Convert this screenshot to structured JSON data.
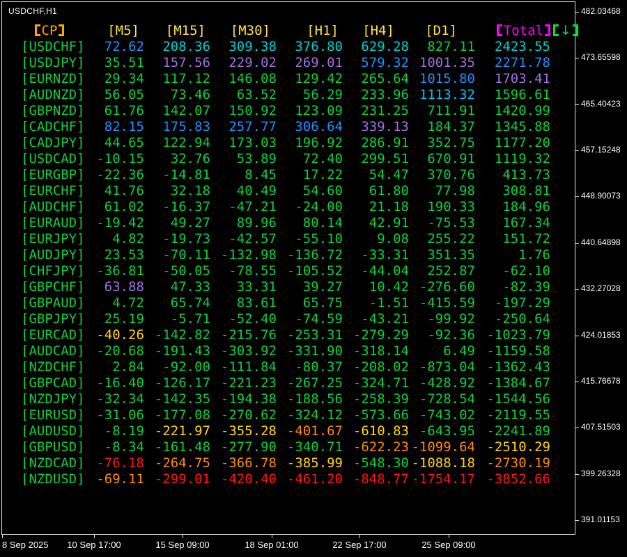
{
  "window": {
    "title": "USDCHF,H1"
  },
  "palette": {
    "background": "#000000",
    "frame": "#E6E6E6",
    "axis_text": "#FFFFFF",
    "pair": "#0ECF3A",
    "green": "#0ECF3A",
    "blue": "#1E90FF",
    "cyan": "#00CED1",
    "sky": "#00BFFF",
    "purple": "#9B72DE",
    "yellow": "#FFD700",
    "orange": "#FF8C00",
    "red": "#FF1414",
    "header_cp": "#FFA500",
    "header_tf": "#FFE135",
    "header_total": "#FF00FF",
    "header_arrow": "#00E62E"
  },
  "table": {
    "header": {
      "cp": "【CP】",
      "timeframes": [
        "[M5]",
        "[M15]",
        "[M30]",
        "[H1]",
        "[H4]",
        "[D1]"
      ],
      "total": "【Total】",
      "sort": "【↓】"
    },
    "rows": [
      {
        "pair": "[USDCHF]",
        "cells": [
          [
            "72.62",
            "blue"
          ],
          [
            "208.36",
            "cyan"
          ],
          [
            "309.38",
            "cyan"
          ],
          [
            "376.80",
            "cyan"
          ],
          [
            "629.28",
            "cyan"
          ],
          [
            "827.11",
            "green"
          ],
          [
            "2423.55",
            "cyan"
          ]
        ]
      },
      {
        "pair": "[USDJPY]",
        "cells": [
          [
            "35.51",
            "green"
          ],
          [
            "157.56",
            "purple"
          ],
          [
            "229.02",
            "purple"
          ],
          [
            "269.01",
            "purple"
          ],
          [
            "579.32",
            "blue"
          ],
          [
            "1001.35",
            "purple"
          ],
          [
            "2271.78",
            "blue"
          ]
        ]
      },
      {
        "pair": "[EURNZD]",
        "cells": [
          [
            "29.34",
            "green"
          ],
          [
            "117.12",
            "green"
          ],
          [
            "146.08",
            "green"
          ],
          [
            "129.42",
            "green"
          ],
          [
            "265.64",
            "green"
          ],
          [
            "1015.80",
            "blue"
          ],
          [
            "1703.41",
            "purple"
          ]
        ]
      },
      {
        "pair": "[AUDNZD]",
        "cells": [
          [
            "56.05",
            "green"
          ],
          [
            "73.46",
            "green"
          ],
          [
            "63.52",
            "green"
          ],
          [
            "56.29",
            "green"
          ],
          [
            "233.96",
            "green"
          ],
          [
            "1113.32",
            "sky"
          ],
          [
            "1596.61",
            "green"
          ]
        ]
      },
      {
        "pair": "[GBPNZD]",
        "cells": [
          [
            "61.76",
            "green"
          ],
          [
            "142.07",
            "green"
          ],
          [
            "150.92",
            "green"
          ],
          [
            "123.09",
            "green"
          ],
          [
            "231.25",
            "green"
          ],
          [
            "711.91",
            "green"
          ],
          [
            "1420.99",
            "green"
          ]
        ]
      },
      {
        "pair": "[CADCHF]",
        "cells": [
          [
            "82.15",
            "blue"
          ],
          [
            "175.83",
            "blue"
          ],
          [
            "257.77",
            "blue"
          ],
          [
            "306.64",
            "blue"
          ],
          [
            "339.13",
            "purple"
          ],
          [
            "184.37",
            "green"
          ],
          [
            "1345.88",
            "green"
          ]
        ]
      },
      {
        "pair": "[CADJPY]",
        "cells": [
          [
            "44.65",
            "green"
          ],
          [
            "122.94",
            "green"
          ],
          [
            "173.03",
            "green"
          ],
          [
            "196.92",
            "green"
          ],
          [
            "286.91",
            "green"
          ],
          [
            "352.75",
            "green"
          ],
          [
            "1177.20",
            "green"
          ]
        ]
      },
      {
        "pair": "[USDCAD]",
        "cells": [
          [
            "-10.15",
            "green"
          ],
          [
            "32.76",
            "green"
          ],
          [
            "53.89",
            "green"
          ],
          [
            "72.40",
            "green"
          ],
          [
            "299.51",
            "green"
          ],
          [
            "670.91",
            "green"
          ],
          [
            "1119.32",
            "green"
          ]
        ]
      },
      {
        "pair": "[EURGBP]",
        "cells": [
          [
            "-22.36",
            "green"
          ],
          [
            "-14.81",
            "green"
          ],
          [
            "8.45",
            "green"
          ],
          [
            "17.22",
            "green"
          ],
          [
            "54.47",
            "green"
          ],
          [
            "370.76",
            "green"
          ],
          [
            "413.73",
            "green"
          ]
        ]
      },
      {
        "pair": "[EURCHF]",
        "cells": [
          [
            "41.76",
            "green"
          ],
          [
            "32.18",
            "green"
          ],
          [
            "40.49",
            "green"
          ],
          [
            "54.60",
            "green"
          ],
          [
            "61.80",
            "green"
          ],
          [
            "77.98",
            "green"
          ],
          [
            "308.81",
            "green"
          ]
        ]
      },
      {
        "pair": "[AUDCHF]",
        "cells": [
          [
            "61.02",
            "green"
          ],
          [
            "-16.37",
            "green"
          ],
          [
            "-47.21",
            "green"
          ],
          [
            "-24.00",
            "green"
          ],
          [
            "21.18",
            "green"
          ],
          [
            "190.33",
            "green"
          ],
          [
            "184.96",
            "green"
          ]
        ]
      },
      {
        "pair": "[EURAUD]",
        "cells": [
          [
            "-19.42",
            "green"
          ],
          [
            "49.27",
            "green"
          ],
          [
            "89.96",
            "green"
          ],
          [
            "80.14",
            "green"
          ],
          [
            "42.91",
            "green"
          ],
          [
            "-75.53",
            "green"
          ],
          [
            "167.34",
            "green"
          ]
        ]
      },
      {
        "pair": "[EURJPY]",
        "cells": [
          [
            "4.82",
            "green"
          ],
          [
            "-19.73",
            "green"
          ],
          [
            "-42.57",
            "green"
          ],
          [
            "-55.10",
            "green"
          ],
          [
            "9.08",
            "green"
          ],
          [
            "255.22",
            "green"
          ],
          [
            "151.72",
            "green"
          ]
        ]
      },
      {
        "pair": "[AUDJPY]",
        "cells": [
          [
            "23.53",
            "green"
          ],
          [
            "-70.11",
            "green"
          ],
          [
            "-132.98",
            "green"
          ],
          [
            "-136.72",
            "green"
          ],
          [
            "-33.31",
            "green"
          ],
          [
            "351.35",
            "green"
          ],
          [
            "1.76",
            "green"
          ]
        ]
      },
      {
        "pair": "[CHFJPY]",
        "cells": [
          [
            "-36.81",
            "green"
          ],
          [
            "-50.05",
            "green"
          ],
          [
            "-78.55",
            "green"
          ],
          [
            "-105.52",
            "green"
          ],
          [
            "-44.04",
            "green"
          ],
          [
            "252.87",
            "green"
          ],
          [
            "-62.10",
            "green"
          ]
        ]
      },
      {
        "pair": "[GBPCHF]",
        "cells": [
          [
            "63.88",
            "purple"
          ],
          [
            "47.33",
            "green"
          ],
          [
            "33.31",
            "green"
          ],
          [
            "39.27",
            "green"
          ],
          [
            "10.42",
            "green"
          ],
          [
            "-276.60",
            "green"
          ],
          [
            "-82.39",
            "green"
          ]
        ]
      },
      {
        "pair": "[GBPAUD]",
        "cells": [
          [
            "4.72",
            "green"
          ],
          [
            "65.74",
            "green"
          ],
          [
            "83.61",
            "green"
          ],
          [
            "65.75",
            "green"
          ],
          [
            "-1.51",
            "green"
          ],
          [
            "-415.59",
            "green"
          ],
          [
            "-197.29",
            "green"
          ]
        ]
      },
      {
        "pair": "[GBPJPY]",
        "cells": [
          [
            "25.19",
            "green"
          ],
          [
            "-5.71",
            "green"
          ],
          [
            "-52.40",
            "green"
          ],
          [
            "-74.59",
            "green"
          ],
          [
            "-43.21",
            "green"
          ],
          [
            "-99.92",
            "green"
          ],
          [
            "-250.64",
            "green"
          ]
        ]
      },
      {
        "pair": "[EURCAD]",
        "cells": [
          [
            "-40.26",
            "yellow"
          ],
          [
            "-142.82",
            "green"
          ],
          [
            "-215.76",
            "green"
          ],
          [
            "-253.31",
            "green"
          ],
          [
            "-279.29",
            "green"
          ],
          [
            "-92.36",
            "green"
          ],
          [
            "-1023.79",
            "green"
          ]
        ]
      },
      {
        "pair": "[AUDCAD]",
        "cells": [
          [
            "-20.68",
            "green"
          ],
          [
            "-191.43",
            "green"
          ],
          [
            "-303.92",
            "green"
          ],
          [
            "-331.90",
            "green"
          ],
          [
            "-318.14",
            "green"
          ],
          [
            "6.49",
            "green"
          ],
          [
            "-1159.58",
            "green"
          ]
        ]
      },
      {
        "pair": "[NZDCHF]",
        "cells": [
          [
            "2.84",
            "green"
          ],
          [
            "-92.00",
            "green"
          ],
          [
            "-111.84",
            "green"
          ],
          [
            "-80.37",
            "green"
          ],
          [
            "-208.02",
            "green"
          ],
          [
            "-873.04",
            "green"
          ],
          [
            "-1362.43",
            "green"
          ]
        ]
      },
      {
        "pair": "[GBPCAD]",
        "cells": [
          [
            "-16.40",
            "green"
          ],
          [
            "-126.17",
            "green"
          ],
          [
            "-221.23",
            "green"
          ],
          [
            "-267.25",
            "green"
          ],
          [
            "-324.71",
            "green"
          ],
          [
            "-428.92",
            "green"
          ],
          [
            "-1384.67",
            "green"
          ]
        ]
      },
      {
        "pair": "[NZDJPY]",
        "cells": [
          [
            "-32.34",
            "green"
          ],
          [
            "-142.35",
            "green"
          ],
          [
            "-194.38",
            "green"
          ],
          [
            "-188.56",
            "green"
          ],
          [
            "-258.39",
            "green"
          ],
          [
            "-728.54",
            "green"
          ],
          [
            "-1544.56",
            "green"
          ]
        ]
      },
      {
        "pair": "[EURUSD]",
        "cells": [
          [
            "-31.06",
            "green"
          ],
          [
            "-177.08",
            "green"
          ],
          [
            "-270.62",
            "green"
          ],
          [
            "-324.12",
            "green"
          ],
          [
            "-573.66",
            "green"
          ],
          [
            "-743.02",
            "green"
          ],
          [
            "-2119.55",
            "green"
          ]
        ]
      },
      {
        "pair": "[AUDUSD]",
        "cells": [
          [
            "-8.19",
            "green"
          ],
          [
            "-221.97",
            "yellow"
          ],
          [
            "-355.28",
            "yellow"
          ],
          [
            "-401.67",
            "orange"
          ],
          [
            "-610.83",
            "yellow"
          ],
          [
            "-643.95",
            "green"
          ],
          [
            "-2241.89",
            "green"
          ]
        ]
      },
      {
        "pair": "[GBPUSD]",
        "cells": [
          [
            "-8.34",
            "green"
          ],
          [
            "-161.48",
            "green"
          ],
          [
            "-277.90",
            "green"
          ],
          [
            "-340.71",
            "green"
          ],
          [
            "-622.23",
            "orange"
          ],
          [
            "-1099.64",
            "orange"
          ],
          [
            "-2510.29",
            "yellow"
          ]
        ]
      },
      {
        "pair": "[NZDCAD]",
        "cells": [
          [
            "-76.18",
            "red"
          ],
          [
            "-264.75",
            "orange"
          ],
          [
            "-366.78",
            "orange"
          ],
          [
            "-385.99",
            "yellow"
          ],
          [
            "-548.30",
            "green"
          ],
          [
            "-1088.18",
            "yellow"
          ],
          [
            "-2730.19",
            "orange"
          ]
        ]
      },
      {
        "pair": "[NZDUSD]",
        "cells": [
          [
            "-69.11",
            "orange"
          ],
          [
            "-299.01",
            "red"
          ],
          [
            "-420.40",
            "red"
          ],
          [
            "-461.20",
            "red"
          ],
          [
            "-848.77",
            "red"
          ],
          [
            "-1754.17",
            "red"
          ],
          [
            "-3852.66",
            "red"
          ]
        ]
      }
    ]
  },
  "price_axis": {
    "labels": [
      "482.03468",
      "473.65598",
      "465.40423",
      "457.15248",
      "448.90073",
      "440.64898",
      "432.27028",
      "424.01853",
      "415.76678",
      "407.51503",
      "399.26328",
      "391.01153"
    ]
  },
  "time_axis": {
    "labels": [
      "8 Sep 2025",
      "10 Sep 17:00",
      "15 Sep 09:00",
      "18 Sep 01:00",
      "22 Sep 17:00",
      "25 Sep 09:00"
    ]
  }
}
